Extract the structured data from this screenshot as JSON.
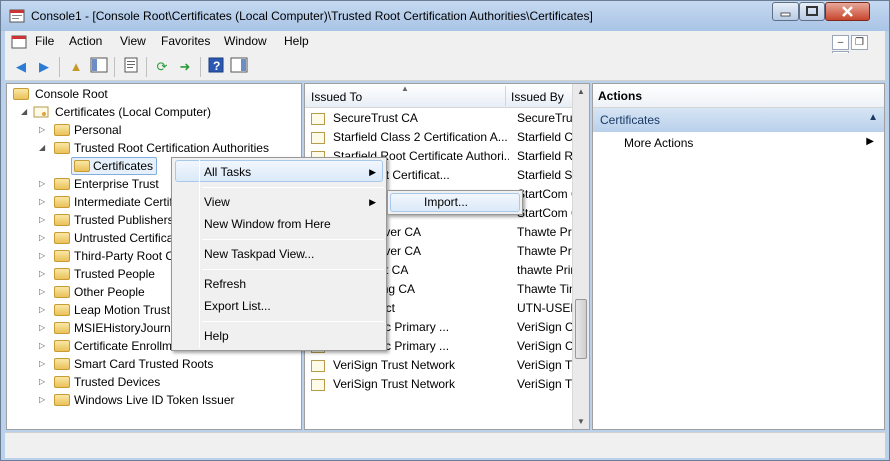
{
  "window": {
    "title": "Console1 - [Console Root\\Certificates (Local Computer)\\Trusted Root Certification Authorities\\Certificates]"
  },
  "menubar": [
    "File",
    "Action",
    "View",
    "Favorites",
    "Window",
    "Help"
  ],
  "toolbar_icons": [
    "back-arrow-icon",
    "forward-arrow-icon",
    "up-folder-icon",
    "show-hide-tree-icon",
    "properties-icon",
    "refresh-icon",
    "export-icon",
    "help-icon",
    "show-hide-action-pane-icon"
  ],
  "tree": {
    "root": "Console Root",
    "computer": "Certificates (Local Computer)",
    "items": [
      {
        "label": "Personal"
      },
      {
        "label": "Trusted Root Certification Authorities"
      },
      {
        "label": "Certificates"
      },
      {
        "label": "Enterprise Trust"
      },
      {
        "label": "Intermediate Certif"
      },
      {
        "label": "Trusted Publishers"
      },
      {
        "label": "Untrusted Certifica"
      },
      {
        "label": "Third-Party Root C"
      },
      {
        "label": "Trusted People"
      },
      {
        "label": "Other People"
      },
      {
        "label": "Leap Motion Trust"
      },
      {
        "label": "MSIEHistoryJourna"
      },
      {
        "label": "Certificate Enrollm"
      },
      {
        "label": "Smart Card Trusted Roots"
      },
      {
        "label": "Trusted Devices"
      },
      {
        "label": "Windows Live ID Token Issuer"
      }
    ]
  },
  "list": {
    "columns": [
      "Issued To",
      "Issued By"
    ],
    "rows": [
      [
        "SecureTrust CA",
        "SecureTrus"
      ],
      [
        "Starfield Class 2 Certification A...",
        "Starfield Cl"
      ],
      [
        "Starfield Root Certificate Authori...",
        "Starfield Ro"
      ],
      [
        "vices Root Certificat...",
        "Starfield Se"
      ],
      [
        "",
        "StartCom C"
      ],
      [
        "",
        "StartCom C"
      ],
      [
        "mium Server CA",
        "Thawte Pre"
      ],
      [
        "mium Server CA",
        "Thawte Pre"
      ],
      [
        "mary Root CA",
        "thawte Prin"
      ],
      [
        "uestamping CA",
        "Thawte Tin"
      ],
      [
        "First-Object",
        "UTN-USER"
      ],
      [
        "ss 3 Public Primary ...",
        "VeriSign Cl"
      ],
      [
        "ss 3 Public Primary ...",
        "VeriSign Cl"
      ],
      [
        "VeriSign Trust Network",
        "VeriSign Tr"
      ],
      [
        "VeriSign Trust Network",
        "VeriSign Tr"
      ]
    ]
  },
  "actions": {
    "title": "Actions",
    "section": "Certificates",
    "more": "More Actions"
  },
  "context_menu": {
    "all_tasks": "All Tasks",
    "view": "View",
    "new_window": "New Window from Here",
    "new_taskpad": "New Taskpad View...",
    "refresh": "Refresh",
    "export": "Export List...",
    "help": "Help"
  },
  "submenu": {
    "import": "Import..."
  },
  "colors": {
    "accent": "#3399ff",
    "titlebar": "#b9d1ea",
    "selection": "#dbe9f8"
  }
}
